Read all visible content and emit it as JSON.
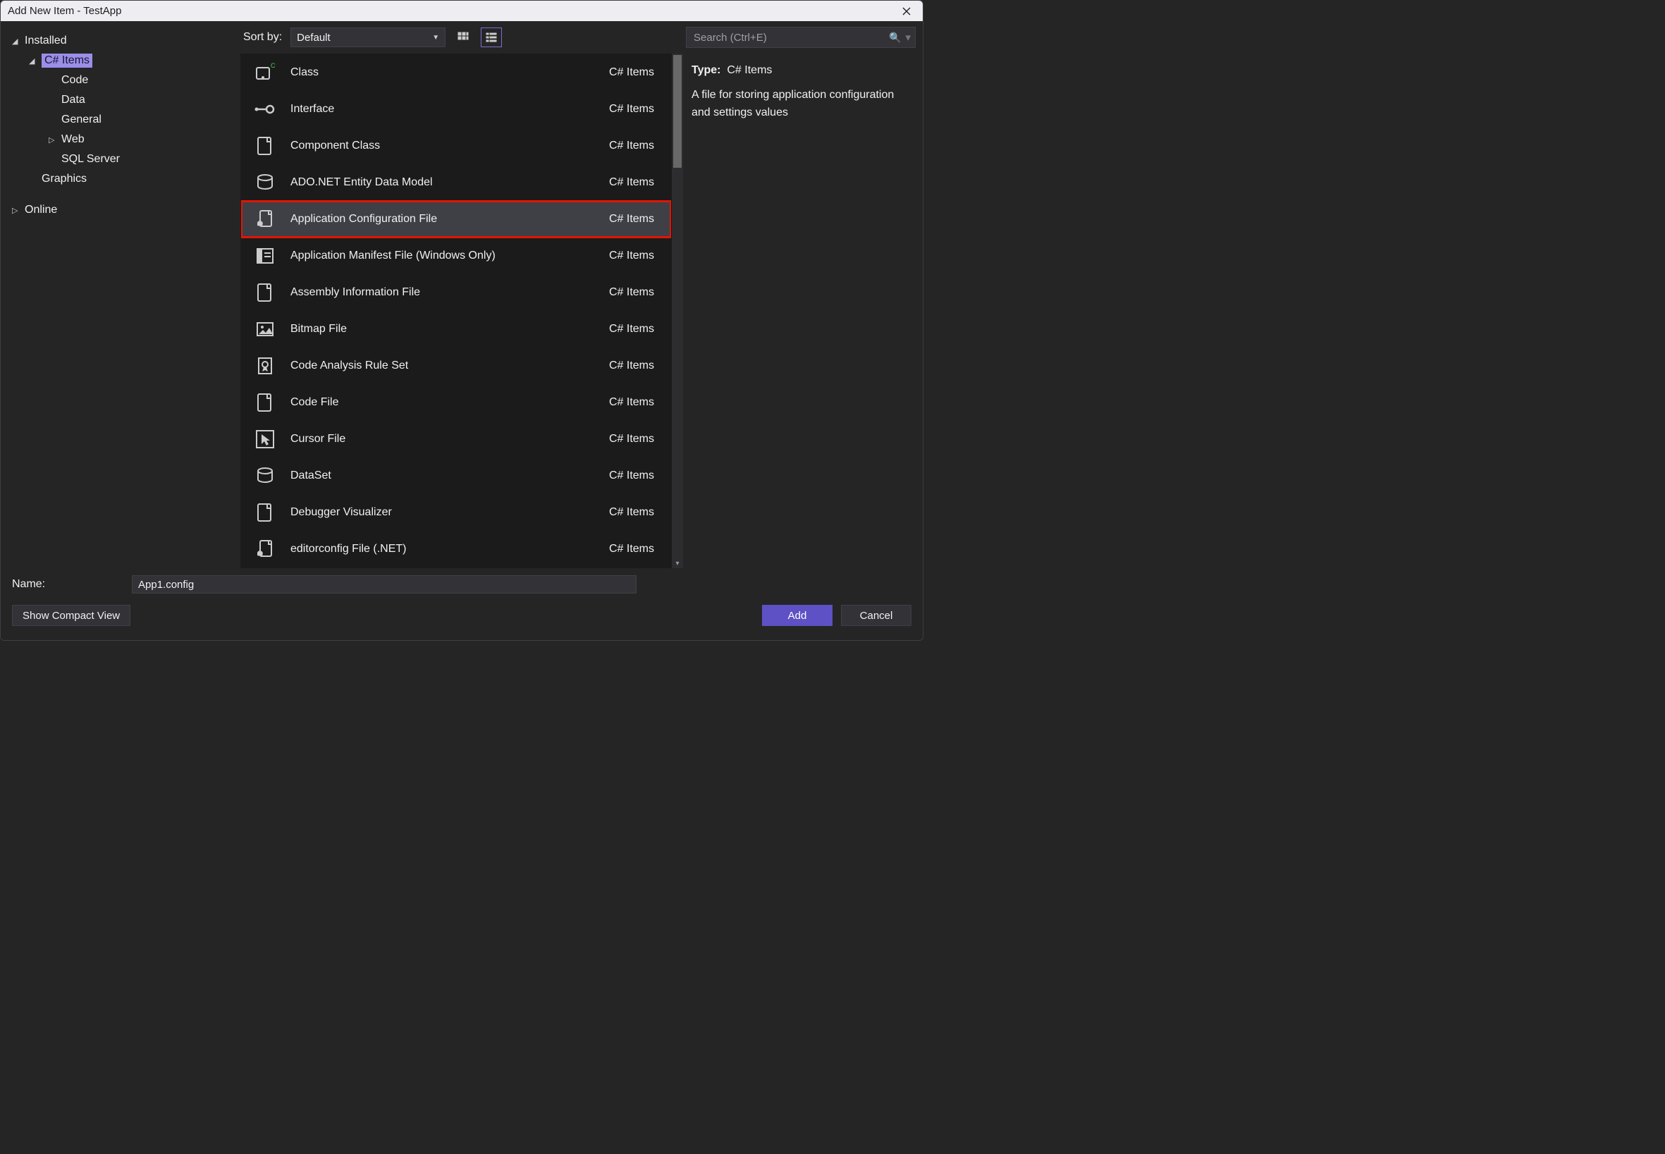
{
  "window": {
    "title": "Add New Item - TestApp"
  },
  "tree": {
    "installed": "Installed",
    "csharp_items": "C# Items",
    "children": [
      "Code",
      "Data",
      "General",
      "Web",
      "SQL Server"
    ],
    "graphics": "Graphics",
    "online": "Online"
  },
  "toolbar": {
    "sort_label": "Sort by:",
    "sort_value": "Default"
  },
  "search": {
    "placeholder": "Search (Ctrl+E)"
  },
  "items": [
    {
      "name": "Class",
      "category": "C# Items"
    },
    {
      "name": "Interface",
      "category": "C# Items"
    },
    {
      "name": "Component Class",
      "category": "C# Items"
    },
    {
      "name": "ADO.NET Entity Data Model",
      "category": "C# Items"
    },
    {
      "name": "Application Configuration File",
      "category": "C# Items",
      "selected": true,
      "highlighted": true
    },
    {
      "name": "Application Manifest File (Windows Only)",
      "category": "C# Items"
    },
    {
      "name": "Assembly Information File",
      "category": "C# Items"
    },
    {
      "name": "Bitmap File",
      "category": "C# Items"
    },
    {
      "name": "Code Analysis Rule Set",
      "category": "C# Items"
    },
    {
      "name": "Code File",
      "category": "C# Items"
    },
    {
      "name": "Cursor File",
      "category": "C# Items"
    },
    {
      "name": "DataSet",
      "category": "C# Items"
    },
    {
      "name": "Debugger Visualizer",
      "category": "C# Items"
    },
    {
      "name": "editorconfig File (.NET)",
      "category": "C# Items"
    }
  ],
  "description": {
    "type_label": "Type:",
    "type_value": "C# Items",
    "text": "A file for storing application configuration and settings values"
  },
  "bottom": {
    "name_label": "Name:",
    "name_value": "App1.config",
    "compact_view": "Show Compact View",
    "add": "Add",
    "cancel": "Cancel"
  }
}
